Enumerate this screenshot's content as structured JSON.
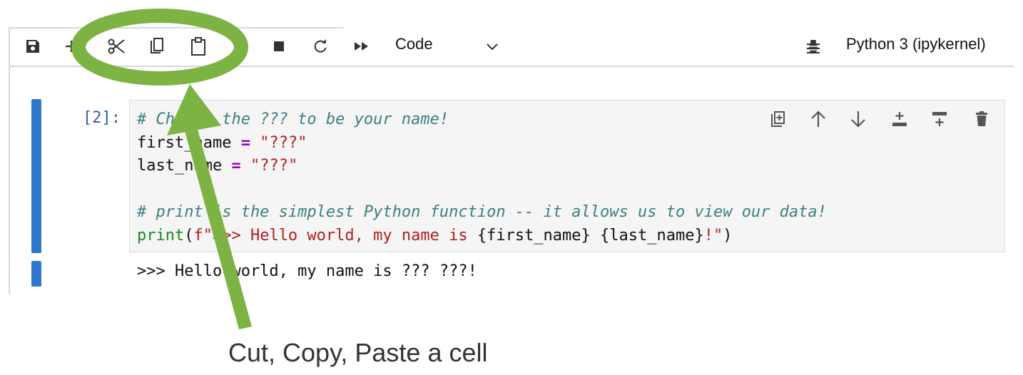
{
  "toolbar": {
    "icons": [
      "save-icon",
      "add-icon",
      "cut-icon",
      "copy-icon",
      "paste-icon",
      "stop-icon",
      "restart-icon",
      "run-all-icon",
      "chevron-down-icon",
      "bug-icon"
    ],
    "cell_type": "Code",
    "kernel": "Python 3 (ipykernel)"
  },
  "cell": {
    "prompt": "[2]:",
    "code": {
      "line1_comment": "# Change the ??? to be your name!",
      "line2_var": "first_name",
      "line2_op": "=",
      "line2_str": "\"???\"",
      "line3_var": "last_name",
      "line3_op": "=",
      "line3_str": "\"???\"",
      "line5_comment": "# print is the simplest Python function -- it allows us to view our data!",
      "line6_func": "print",
      "line6_paren_open": "(",
      "line6_str_start": "f\">>> Hello world, my name is ",
      "line6_fields": "{first_name} {last_name}",
      "line6_str_end": "!\"",
      "line6_paren_close": ")"
    },
    "output": ">>> Hello world, my name is ??? ???!",
    "actions": [
      "duplicate-icon",
      "move-up-icon",
      "move-down-icon",
      "insert-above-icon",
      "insert-below-icon",
      "delete-icon"
    ]
  },
  "annotation": {
    "caption": "Cut, Copy, Paste a cell",
    "color": "#7cb342"
  },
  "colors": {
    "cell_bar": "#2f77c9",
    "prompt": "#3060a8"
  }
}
